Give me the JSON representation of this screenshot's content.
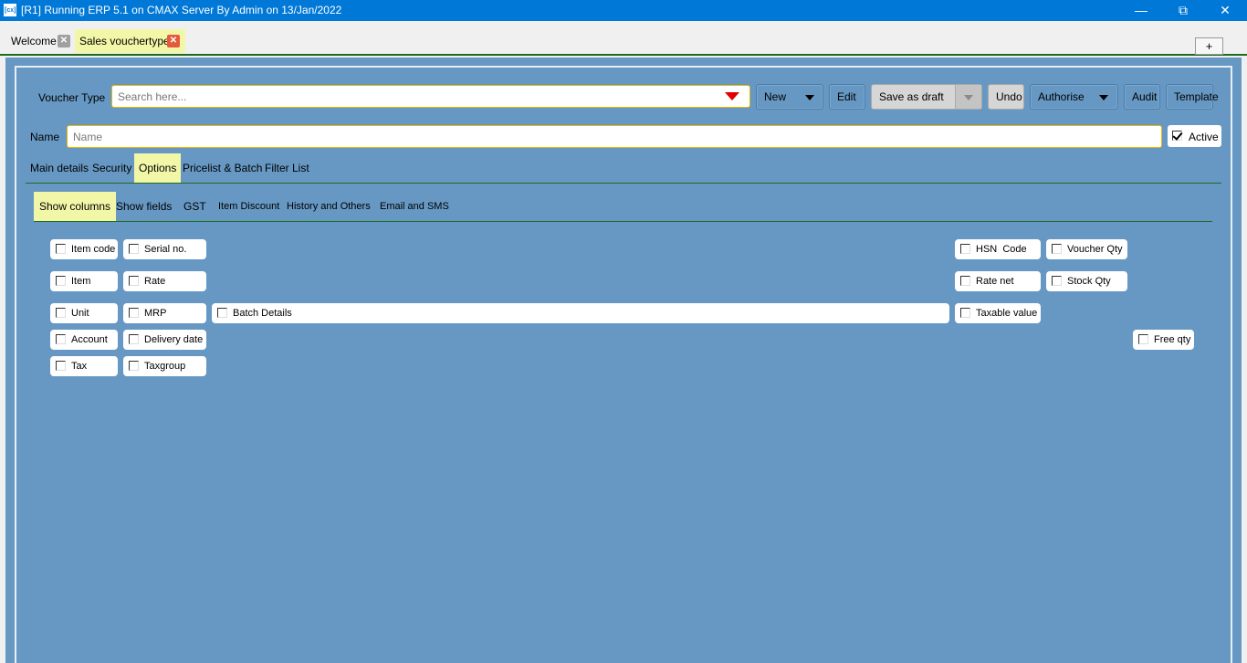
{
  "window": {
    "app_icon": "[cx]",
    "title": "[R1] Running ERP 5.1 on CMAX Server By Admin on 13/Jan/2022",
    "minimize_icon": "minimize-icon",
    "restore_icon": "restore-icon",
    "close_icon": "close-icon"
  },
  "doc_tabs": [
    {
      "label": "Welcome"
    },
    {
      "label": "Sales vouchertype"
    }
  ],
  "plus_label": "+",
  "form": {
    "voucher_type_label": "Voucher Type",
    "search_placeholder": "Search here...",
    "name_label": "Name",
    "name_placeholder": "Name",
    "active_label": "Active"
  },
  "toolbar": {
    "new_label": "New",
    "edit_label": "Edit",
    "save_draft_label": "Save as draft",
    "undo_label": "Undo",
    "authorise_label": "Authorise",
    "audit_label": "Audit",
    "template_label": "Template"
  },
  "main_tabs": [
    "Main details",
    "Security",
    "Options",
    "Pricelist & Batch",
    "Filter List"
  ],
  "sub_tabs": [
    "Show columns",
    "Show fields",
    "GST",
    "Item Discount",
    "History and Others",
    "Email and SMS"
  ],
  "columns": {
    "item_code": "Item code",
    "serial_no": "Serial no.",
    "item": "Item",
    "rate": "Rate",
    "unit": "Unit",
    "mrp": "MRP",
    "batch_details": "Batch Details",
    "account": "Account",
    "delivery_date": "Delivery date",
    "tax": "Tax",
    "taxgroup": "Taxgroup",
    "hsn_code": "HSN  Code",
    "voucher_qty": "Voucher Qty",
    "rate_net": "Rate net",
    "stock_qty": "Stock Qty",
    "taxable_value": "Taxable value",
    "free_qty": "Free qty"
  },
  "colors": {
    "titlebar": "#0078d7",
    "panel": "#6698c3",
    "tab_highlight": "#f2f7a8",
    "accent_line": "#1e6b1e",
    "dropdown_arrow": "#e00000"
  }
}
